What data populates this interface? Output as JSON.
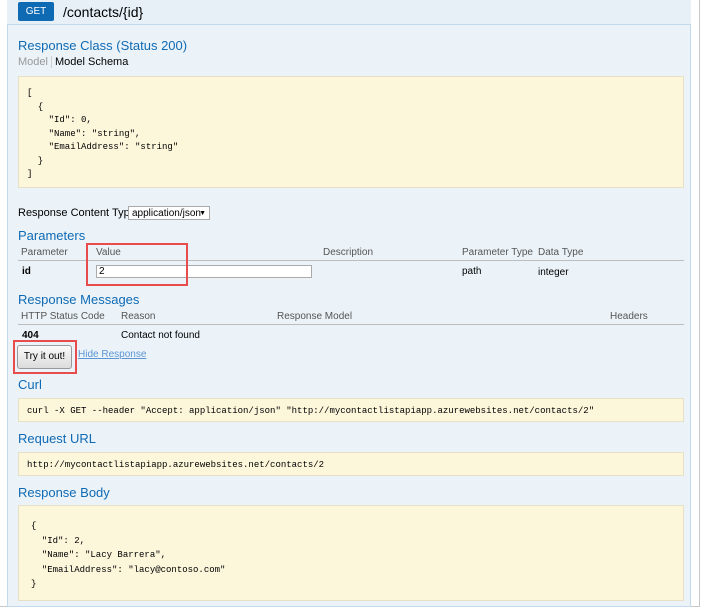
{
  "operation": {
    "method": "GET",
    "path": "/contacts/{id}"
  },
  "response_class": {
    "title": "Response Class (Status 200)",
    "tabs": [
      "Model",
      "Model Schema"
    ],
    "schema_lines": [
      "[",
      "  {",
      "    \"Id\": 0,",
      "    \"Name\": \"string\",",
      "    \"EmailAddress\": \"string\"",
      "  }",
      "]"
    ]
  },
  "content_type": {
    "label": "Response Content Type",
    "selected": "application/json"
  },
  "parameters": {
    "title": "Parameters",
    "headers": [
      "Parameter",
      "Value",
      "Description",
      "Parameter Type",
      "Data Type"
    ],
    "rows": [
      {
        "name": "id",
        "value": "2",
        "description": "",
        "param_type": "path",
        "data_type": "integer"
      }
    ]
  },
  "response_messages": {
    "title": "Response Messages",
    "headers": [
      "HTTP Status Code",
      "Reason",
      "Response Model",
      "Headers"
    ],
    "rows": [
      {
        "code": "404",
        "reason": "Contact not found"
      }
    ]
  },
  "actions": {
    "try_it": "Try it out!",
    "hide_response": "Hide Response"
  },
  "curl": {
    "title": "Curl",
    "command": "curl -X GET --header \"Accept: application/json\" \"http://mycontactlistapiapp.azurewebsites.net/contacts/2\""
  },
  "request_url": {
    "title": "Request URL",
    "url": "http://mycontactlistapiapp.azurewebsites.net/contacts/2"
  },
  "response_body": {
    "title": "Response Body",
    "lines": [
      "{",
      "  \"Id\": 2,",
      "  \"Name\": \"Lacy Barrera\",",
      "  \"EmailAddress\": \"lacy@contoso.com\"",
      "}"
    ]
  },
  "colors": {
    "get_badge": "#0f6ab4",
    "section_title": "#0f6ab4",
    "code_bg": "#fcf6db",
    "highlight": "#e84d4d",
    "panel_bg": "#ebf3f9"
  }
}
